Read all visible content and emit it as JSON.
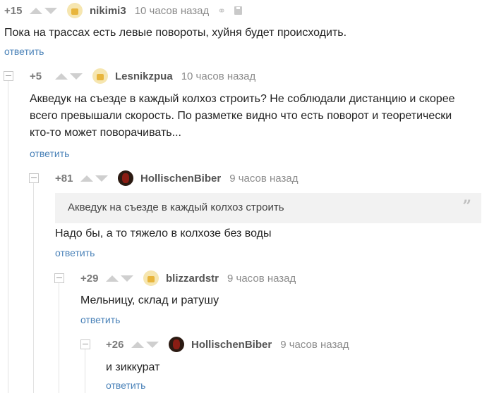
{
  "comments": [
    {
      "rating": "+15",
      "user": "nikimi3",
      "time": "10 часов назад",
      "lines": [
        "Пока на трассах есть левые повороты, хуйня будет происходить."
      ],
      "reply": "ответить"
    },
    {
      "rating": "+5",
      "user": "Lesnikzpua",
      "time": "10 часов назад",
      "lines": [
        "Акведук на съезде в каждый колхоз строить? Не соблюдали дистанцию и скорее",
        "всего превышали скорость. По разметке видно что есть поворот и теоретически",
        "кто-то может поворачивать..."
      ],
      "reply": "ответить"
    },
    {
      "rating": "+81",
      "user": "HollischenBiber",
      "time": "9 часов назад",
      "quote": "Акведук на съезде в каждый колхоз строить",
      "lines": [
        "Надо бы, а то тяжело в колхозе без воды"
      ],
      "reply": "ответить"
    },
    {
      "rating": "+29",
      "user": "blizzardstr",
      "time": "9 часов назад",
      "lines": [
        "Мельницу, склад и ратушу"
      ],
      "reply": "ответить"
    },
    {
      "rating": "+26",
      "user": "HollischenBiber",
      "time": "9 часов назад",
      "lines": [
        "и зиккурат"
      ],
      "reply": "ответить"
    }
  ],
  "icons": {
    "link": "link-icon",
    "save": "save-icon",
    "quote": "quote-icon",
    "collapse": "collapse-icon",
    "vote_up": "arrow-up-icon",
    "vote_down": "arrow-down-icon"
  }
}
